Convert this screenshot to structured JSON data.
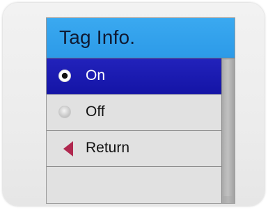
{
  "menu": {
    "title": "Tag Info.",
    "items": [
      {
        "label": "On",
        "icon": "radio-selected-icon",
        "selected": true
      },
      {
        "label": "Off",
        "icon": "radio-unselected-icon",
        "selected": false
      },
      {
        "label": "Return",
        "icon": "back-arrow-icon",
        "selected": false
      }
    ]
  },
  "colors": {
    "title_bar": "#2c9ae8",
    "selection": "#1414a6",
    "return_arrow": "#b0284f",
    "frame": "#eeeeee"
  }
}
